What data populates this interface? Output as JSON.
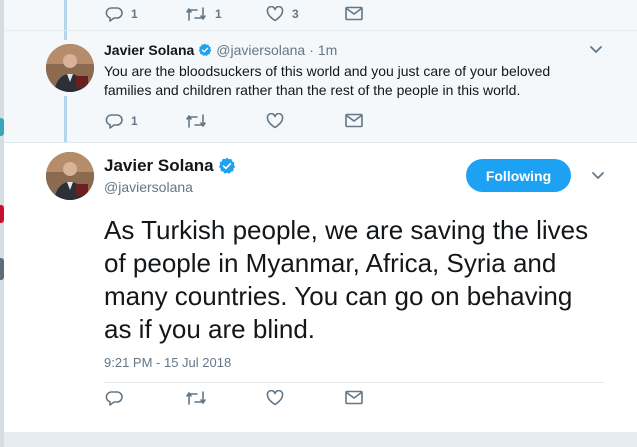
{
  "top_tweet": {
    "reply_count": "1",
    "retweet_count": "1",
    "like_count": "3"
  },
  "reply_tweet": {
    "author_name": "Javier Solana",
    "author_handle": "@javiersolana",
    "separator": "·",
    "timestamp": "1m",
    "text": "You are the bloodsuckers of this world and you just care of your beloved families and children rather than the rest of the people in this world.",
    "reply_count": "1"
  },
  "main_tweet": {
    "author_name": "Javier Solana",
    "author_handle": "@javiersolana",
    "follow_label": "Following",
    "text": "As Turkish people, we are saving the lives of people in Myanmar, Africa, Syria and many countries. You can go on behaving as if you are blind.",
    "date": "9:21 PM - 15 Jul 2018"
  },
  "icons": {
    "reply": "reply-icon",
    "retweet": "retweet-icon",
    "like": "heart-icon",
    "message": "envelope-icon",
    "verified": "verified-badge-icon",
    "more": "chevron-down-icon"
  },
  "colors": {
    "brand": "#1da1f2",
    "text": "#14171a",
    "muted": "#657786",
    "thread_line": "#b3d5ee"
  }
}
